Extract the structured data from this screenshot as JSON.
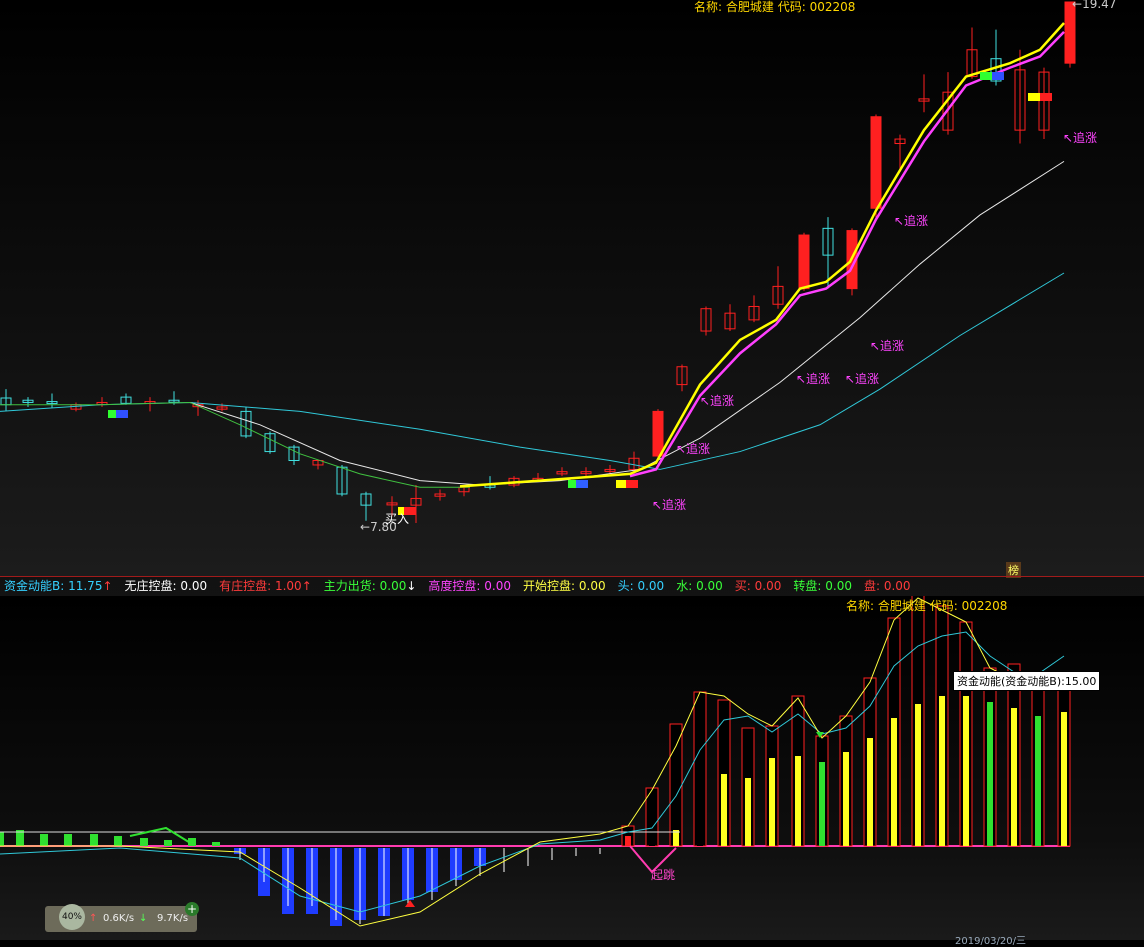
{
  "stock": {
    "name_label": "名称:",
    "name": "合肥城建",
    "code_label": "代码:",
    "code": "002208"
  },
  "top_chart": {
    "max_price_label": "19.47",
    "min_price_label": "7.80",
    "buy_label": "买入",
    "chase_labels": [
      "追涨",
      "追涨",
      "追涨",
      "追涨",
      "追涨",
      "追涨",
      "追涨",
      "追涨"
    ],
    "bang_label": "榜"
  },
  "indicator_bar": {
    "items": [
      {
        "label": "资金动能B:",
        "value": "11.75",
        "arrow": "↑",
        "color": "#35d0ff"
      },
      {
        "label": "无庄控盘:",
        "value": "0.00",
        "arrow": "",
        "color": "#ffffff"
      },
      {
        "label": "有庄控盘:",
        "value": "1.00",
        "arrow": "↑",
        "color": "#ff3b3b"
      },
      {
        "label": "主力出货:",
        "value": "0.00",
        "arrow": "↓",
        "color": "#39ff39"
      },
      {
        "label": "高度控盘:",
        "value": "0.00",
        "arrow": "",
        "color": "#ff44ff"
      },
      {
        "label": "开始控盘:",
        "value": "0.00",
        "arrow": "",
        "color": "#ffff44"
      },
      {
        "label": "头:",
        "value": "0.00",
        "arrow": "",
        "color": "#35d0ff"
      },
      {
        "label": "水:",
        "value": "0.00",
        "arrow": "",
        "color": "#39ff39"
      },
      {
        "label": "买:",
        "value": "0.00",
        "arrow": "",
        "color": "#ff3b3b"
      },
      {
        "label": "转盘:",
        "value": "0.00",
        "arrow": "",
        "color": "#39ff39"
      },
      {
        "label": "盘:",
        "value": "0.00",
        "arrow": "",
        "color": "#ff3b3b"
      }
    ]
  },
  "bottom_chart": {
    "tooltip": "资金动能(资金动能B):15.00",
    "jump_label": "起跳",
    "date_label": "2019/03/20/三"
  },
  "net_widget": {
    "percent": "40%",
    "upload": "0.6K/s",
    "download": "9.7K/s"
  },
  "colors": {
    "up": "#ff2020",
    "down": "#40e0e0",
    "ma_yellow": "#ffff00",
    "ma_magenta": "#ff40ff",
    "ma_white": "#e8e8e8",
    "ma_cyan": "#30c8d8",
    "ma_green": "#40c040"
  }
}
